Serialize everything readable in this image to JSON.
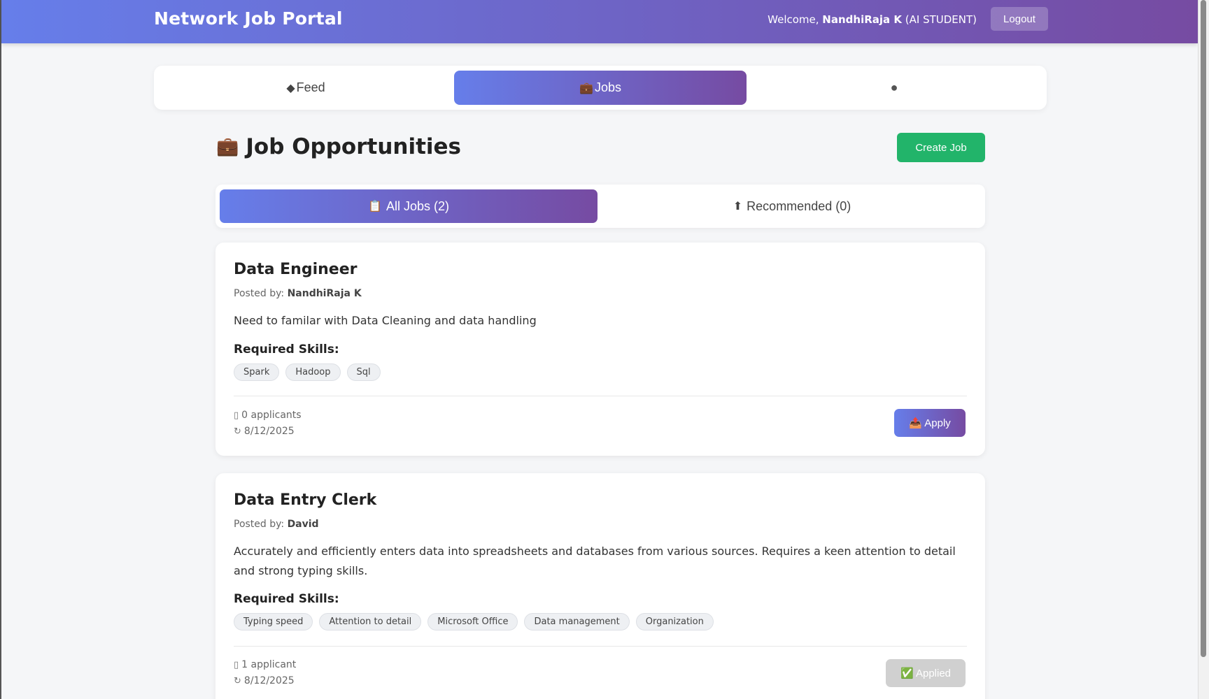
{
  "header": {
    "brand": "Network Job Portal",
    "welcome_prefix": "Welcome, ",
    "user_name": "NandhiRaja K",
    "user_role": " (AI STUDENT)",
    "logout_label": "Logout"
  },
  "nav": {
    "tabs": [
      {
        "label": "Feed",
        "icon": "tag-icon",
        "glyph": "◆",
        "active": false
      },
      {
        "label": "Jobs",
        "icon": "briefcase-icon",
        "glyph": "💼",
        "active": true
      },
      {
        "label": "",
        "icon": "user-circle-icon",
        "glyph": "●",
        "active": false
      }
    ]
  },
  "page": {
    "title": "Job Opportunities",
    "create_label": "Create Job"
  },
  "filters": {
    "all_label": "All Jobs (2)",
    "recommended_label": "Recommended (0)"
  },
  "jobs": [
    {
      "title": "Data Engineer",
      "posted_prefix": "Posted by: ",
      "poster": "NandhiRaja K",
      "description": "Need to familar with Data Cleaning and data handling",
      "skills_label": "Required Skills:",
      "skills": [
        "Spark",
        "Hadoop",
        "Sql"
      ],
      "applicants": "0 applicants",
      "date": "8/12/2025",
      "action_label": "Apply",
      "applied": false
    },
    {
      "title": "Data Entry Clerk",
      "posted_prefix": "Posted by: ",
      "poster": "David",
      "description": "Accurately and efficiently enters data into spreadsheets and databases from various sources. Requires a keen attention to detail and strong typing skills.",
      "skills_label": "Required Skills:",
      "skills": [
        "Typing speed",
        "Attention to detail",
        "Microsoft Office",
        "Data management",
        "Organization"
      ],
      "applicants": "1 applicant",
      "date": "8/12/2025",
      "action_label": "Applied",
      "applied": true
    }
  ],
  "colors": {
    "header_gradient_start": "#667eea",
    "header_gradient_end": "#764ba2",
    "create_button": "#22b46a",
    "applied_button": "#d0d0d0"
  }
}
